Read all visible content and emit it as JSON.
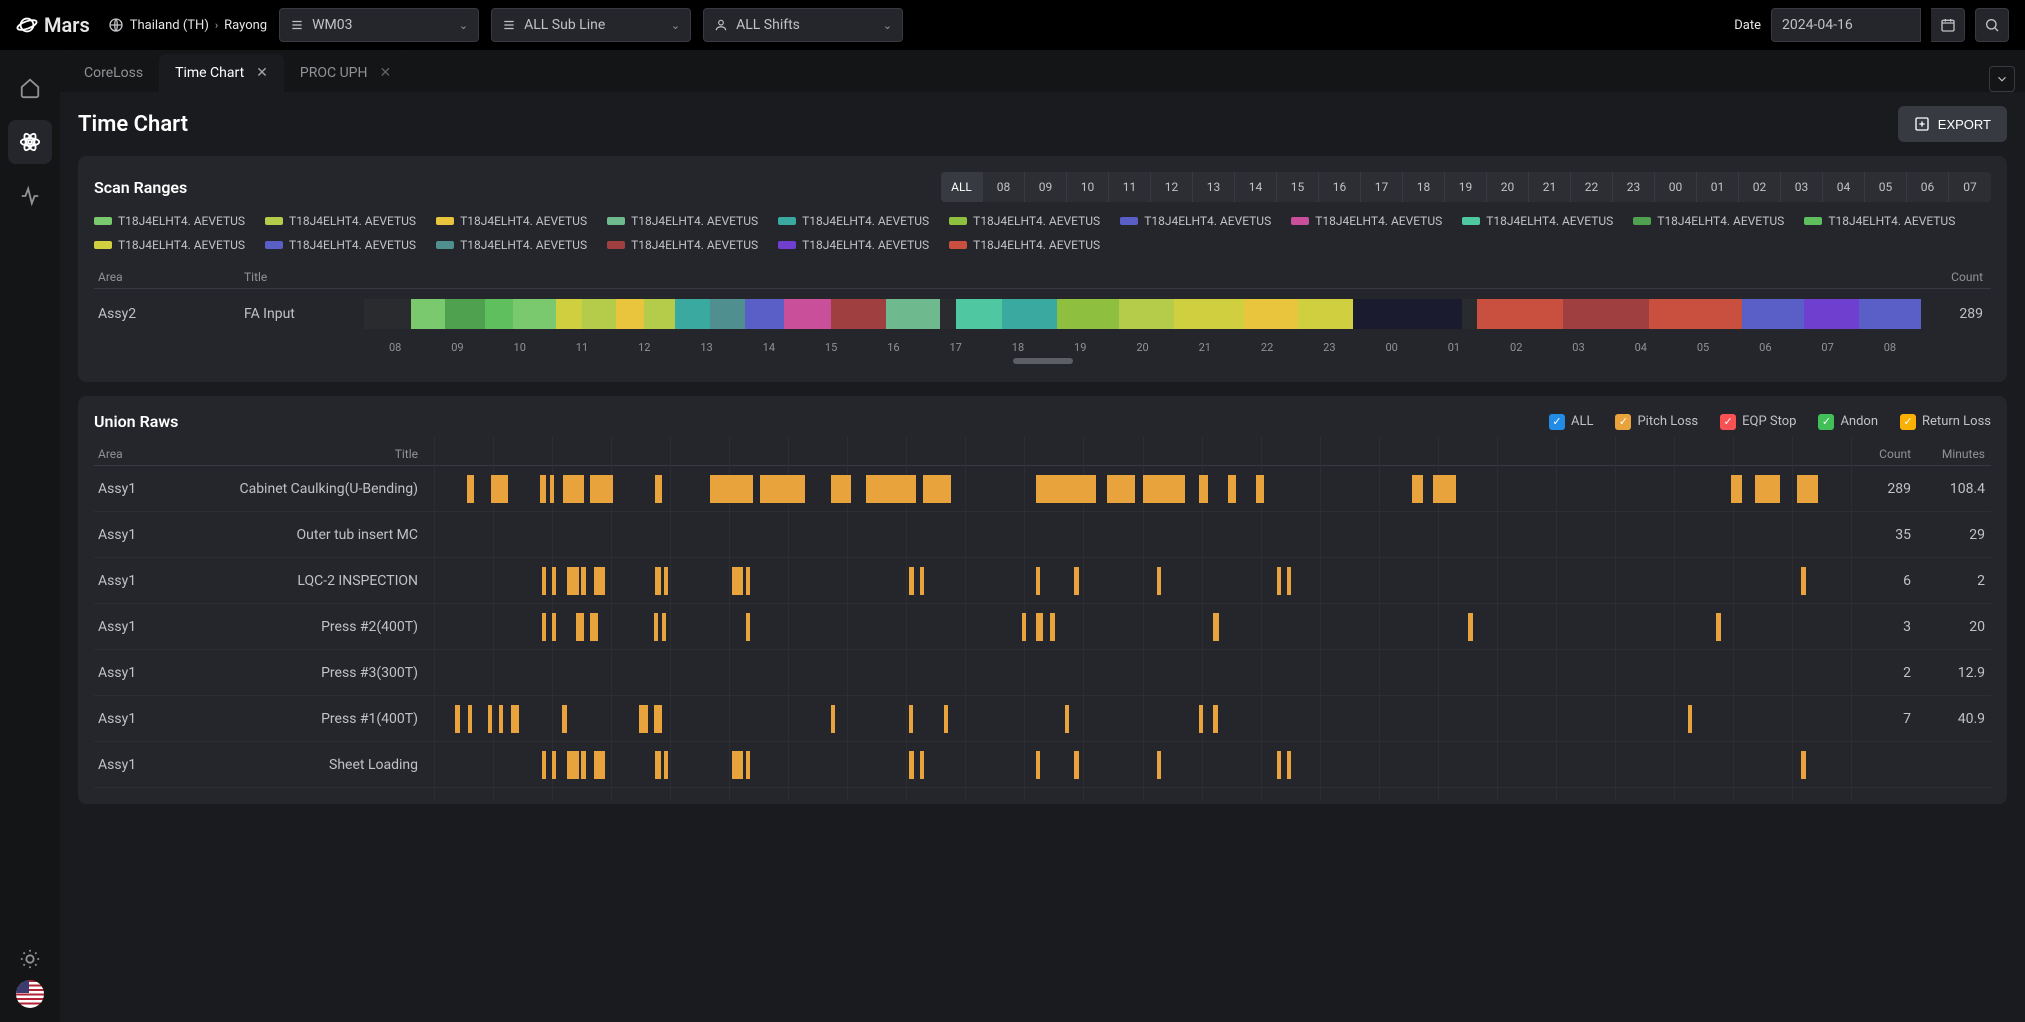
{
  "brand": "Mars",
  "breadcrumb": {
    "region": "Thailand (TH)",
    "factory": "Rayong"
  },
  "selects": {
    "wm": "WM03",
    "subline": "ALL Sub Line",
    "shift": "ALL Shifts"
  },
  "date_label": "Date",
  "date_value": "2024-04-16",
  "tabs": [
    {
      "id": "coreloss",
      "label": "CoreLoss",
      "active": false,
      "closable": false
    },
    {
      "id": "timechart",
      "label": "Time Chart",
      "active": true,
      "closable": true
    },
    {
      "id": "procuph",
      "label": "PROC UPH",
      "active": false,
      "closable": true
    }
  ],
  "page_title": "Time Chart",
  "export_label": "EXPORT",
  "scan": {
    "title": "Scan Ranges",
    "hours": [
      "ALL",
      "08",
      "09",
      "10",
      "11",
      "12",
      "13",
      "14",
      "15",
      "16",
      "17",
      "18",
      "19",
      "20",
      "21",
      "22",
      "23",
      "00",
      "01",
      "02",
      "03",
      "04",
      "05",
      "06",
      "07"
    ],
    "active_hour": "ALL",
    "legend_label": "T18J4ELHT4. AEVETUS",
    "legend_colors": [
      "#7bc96f",
      "#b5cc4a",
      "#e8c53d",
      "#6fb98f",
      "#3aa99f",
      "#8fbf3f",
      "#5a5fc7",
      "#c94f9a",
      "#4fc7a0",
      "#4fa04f",
      "#5fbf5f",
      "#cfcf3f",
      "#5a5fc7",
      "#4f8f8f",
      "#9f3f3f",
      "#6f3fcf",
      "#c94f3f"
    ],
    "headers": {
      "area": "Area",
      "title": "Title",
      "count": "Count"
    },
    "row": {
      "area": "Assy2",
      "title": "FA Input",
      "count": 289
    },
    "axis": [
      "08",
      "09",
      "10",
      "11",
      "12",
      "13",
      "14",
      "15",
      "16",
      "17",
      "18",
      "19",
      "20",
      "21",
      "22",
      "23",
      "00",
      "01",
      "02",
      "03",
      "04",
      "05",
      "06",
      "07",
      "08"
    ],
    "segments": [
      {
        "s": 0.0,
        "e": 3.0,
        "c": "#2a2b2e"
      },
      {
        "s": 3.0,
        "e": 5.2,
        "c": "#7bc96f"
      },
      {
        "s": 5.2,
        "e": 7.8,
        "c": "#4fa04f"
      },
      {
        "s": 7.8,
        "e": 9.6,
        "c": "#5fbf5f"
      },
      {
        "s": 9.6,
        "e": 12.3,
        "c": "#7bc96f"
      },
      {
        "s": 12.3,
        "e": 14.0,
        "c": "#cfcf3f"
      },
      {
        "s": 14.0,
        "e": 16.2,
        "c": "#b5cc4a"
      },
      {
        "s": 16.2,
        "e": 18.0,
        "c": "#e8c53d"
      },
      {
        "s": 18.0,
        "e": 20.0,
        "c": "#b5cc4a"
      },
      {
        "s": 20.0,
        "e": 22.2,
        "c": "#3aa99f"
      },
      {
        "s": 22.2,
        "e": 24.5,
        "c": "#4f8f8f"
      },
      {
        "s": 24.5,
        "e": 27.0,
        "c": "#5a5fc7"
      },
      {
        "s": 27.0,
        "e": 30.0,
        "c": "#c94f9a"
      },
      {
        "s": 30.0,
        "e": 33.5,
        "c": "#9f3f3f"
      },
      {
        "s": 33.5,
        "e": 37.0,
        "c": "#6fb98f"
      },
      {
        "s": 37.0,
        "e": 38.0,
        "c": "#2a2b2e"
      },
      {
        "s": 38.0,
        "e": 41.0,
        "c": "#4fc7a0"
      },
      {
        "s": 41.0,
        "e": 44.5,
        "c": "#3aa99f"
      },
      {
        "s": 44.5,
        "e": 48.5,
        "c": "#8fbf3f"
      },
      {
        "s": 48.5,
        "e": 52.0,
        "c": "#b5cc4a"
      },
      {
        "s": 52.0,
        "e": 56.5,
        "c": "#cfcf3f"
      },
      {
        "s": 56.5,
        "e": 60.0,
        "c": "#e8c53d"
      },
      {
        "s": 60.0,
        "e": 63.5,
        "c": "#cfcf3f"
      },
      {
        "s": 63.5,
        "e": 70.5,
        "c": "#1a1b2e"
      },
      {
        "s": 70.5,
        "e": 71.5,
        "c": "#2a2b2e"
      },
      {
        "s": 71.5,
        "e": 77.0,
        "c": "#c94f3f"
      },
      {
        "s": 77.0,
        "e": 82.5,
        "c": "#9f3f3f"
      },
      {
        "s": 82.5,
        "e": 88.5,
        "c": "#c94f3f"
      },
      {
        "s": 88.5,
        "e": 92.5,
        "c": "#5a5fc7"
      },
      {
        "s": 92.5,
        "e": 96.0,
        "c": "#6f3fcf"
      },
      {
        "s": 96.0,
        "e": 100.0,
        "c": "#5a5fc7"
      }
    ]
  },
  "union": {
    "title": "Union Raws",
    "filters": [
      {
        "label": "ALL",
        "color": "#228be6"
      },
      {
        "label": "Pitch Loss",
        "color": "#e8a33d"
      },
      {
        "label": "EQP Stop",
        "color": "#fa5252"
      },
      {
        "label": "Andon",
        "color": "#40c057"
      },
      {
        "label": "Return Loss",
        "color": "#fab005"
      }
    ],
    "headers": {
      "area": "Area",
      "title": "Title",
      "count": "Count",
      "minutes": "Minutes"
    },
    "rows": [
      {
        "area": "Assy1",
        "title": "Cabinet Caulking(U-Bending)",
        "count": 289,
        "minutes": 108.4,
        "segs": [
          {
            "s": 2.3,
            "w": 0.5
          },
          {
            "s": 4.0,
            "w": 1.2
          },
          {
            "s": 7.5,
            "w": 0.4
          },
          {
            "s": 8.2,
            "w": 0.3
          },
          {
            "s": 9.1,
            "w": 1.5
          },
          {
            "s": 11.0,
            "w": 1.6
          },
          {
            "s": 15.6,
            "w": 0.5
          },
          {
            "s": 19.5,
            "w": 3.0
          },
          {
            "s": 23.0,
            "w": 3.2
          },
          {
            "s": 28.0,
            "w": 1.4
          },
          {
            "s": 30.5,
            "w": 3.5
          },
          {
            "s": 34.5,
            "w": 2.0
          },
          {
            "s": 42.5,
            "w": 4.2
          },
          {
            "s": 47.5,
            "w": 2.0
          },
          {
            "s": 50.0,
            "w": 3.0
          },
          {
            "s": 54.0,
            "w": 0.6
          },
          {
            "s": 56.0,
            "w": 0.6
          },
          {
            "s": 58.0,
            "w": 0.6
          },
          {
            "s": 69.0,
            "w": 0.8
          },
          {
            "s": 70.5,
            "w": 1.6
          },
          {
            "s": 91.5,
            "w": 0.8
          },
          {
            "s": 93.2,
            "w": 1.8
          },
          {
            "s": 96.2,
            "w": 1.5
          }
        ]
      },
      {
        "area": "Assy1",
        "title": "Outer tub insert MC",
        "count": 35,
        "minutes": 29.0,
        "segs": []
      },
      {
        "area": "Assy1",
        "title": "LQC-2 INSPECTION",
        "count": 6,
        "minutes": 2.0,
        "segs": [
          {
            "s": 7.6,
            "w": 0.3
          },
          {
            "s": 8.3,
            "w": 0.3
          },
          {
            "s": 9.4,
            "w": 0.8
          },
          {
            "s": 10.4,
            "w": 0.3
          },
          {
            "s": 11.3,
            "w": 0.8
          },
          {
            "s": 15.6,
            "w": 0.4
          },
          {
            "s": 16.2,
            "w": 0.3
          },
          {
            "s": 21.0,
            "w": 0.8
          },
          {
            "s": 22.0,
            "w": 0.3
          },
          {
            "s": 33.5,
            "w": 0.4
          },
          {
            "s": 34.3,
            "w": 0.3
          },
          {
            "s": 42.5,
            "w": 0.3
          },
          {
            "s": 45.2,
            "w": 0.3
          },
          {
            "s": 51.0,
            "w": 0.3
          },
          {
            "s": 59.5,
            "w": 0.3
          },
          {
            "s": 60.2,
            "w": 0.3
          },
          {
            "s": 96.5,
            "w": 0.3
          }
        ]
      },
      {
        "area": "Assy1",
        "title": "Press #2(400T)",
        "count": 3,
        "minutes": 20.0,
        "segs": [
          {
            "s": 7.6,
            "w": 0.3
          },
          {
            "s": 8.3,
            "w": 0.3
          },
          {
            "s": 10.0,
            "w": 0.6
          },
          {
            "s": 11.0,
            "w": 0.6
          },
          {
            "s": 15.5,
            "w": 0.3
          },
          {
            "s": 16.1,
            "w": 0.3
          },
          {
            "s": 22.0,
            "w": 0.3
          },
          {
            "s": 41.5,
            "w": 0.3
          },
          {
            "s": 42.5,
            "w": 0.5
          },
          {
            "s": 43.5,
            "w": 0.3
          },
          {
            "s": 55.0,
            "w": 0.4
          },
          {
            "s": 73.0,
            "w": 0.3
          },
          {
            "s": 90.5,
            "w": 0.3
          }
        ]
      },
      {
        "area": "Assy1",
        "title": "Press #3(300T)",
        "count": 2,
        "minutes": 12.9,
        "segs": []
      },
      {
        "area": "Assy1",
        "title": "Press #1(400T)",
        "count": 7,
        "minutes": 40.9,
        "segs": [
          {
            "s": 1.5,
            "w": 0.3
          },
          {
            "s": 2.4,
            "w": 0.3
          },
          {
            "s": 3.8,
            "w": 0.3
          },
          {
            "s": 4.6,
            "w": 0.3
          },
          {
            "s": 5.4,
            "w": 0.6
          },
          {
            "s": 9.0,
            "w": 0.4
          },
          {
            "s": 14.5,
            "w": 0.6
          },
          {
            "s": 15.5,
            "w": 0.6
          },
          {
            "s": 28.0,
            "w": 0.3
          },
          {
            "s": 33.5,
            "w": 0.3
          },
          {
            "s": 36.0,
            "w": 0.3
          },
          {
            "s": 44.5,
            "w": 0.3
          },
          {
            "s": 54.0,
            "w": 0.3
          },
          {
            "s": 55.0,
            "w": 0.3
          },
          {
            "s": 88.5,
            "w": 0.3
          }
        ]
      },
      {
        "area": "Assy1",
        "title": "Sheet Loading",
        "count": "",
        "minutes": "",
        "segs": [
          {
            "s": 7.6,
            "w": 0.3
          },
          {
            "s": 8.3,
            "w": 0.3
          },
          {
            "s": 9.4,
            "w": 0.8
          },
          {
            "s": 10.4,
            "w": 0.3
          },
          {
            "s": 11.3,
            "w": 0.8
          },
          {
            "s": 15.6,
            "w": 0.4
          },
          {
            "s": 16.2,
            "w": 0.3
          },
          {
            "s": 21.0,
            "w": 0.8
          },
          {
            "s": 22.0,
            "w": 0.3
          },
          {
            "s": 33.5,
            "w": 0.4
          },
          {
            "s": 34.3,
            "w": 0.3
          },
          {
            "s": 42.5,
            "w": 0.3
          },
          {
            "s": 45.2,
            "w": 0.3
          },
          {
            "s": 51.0,
            "w": 0.3
          },
          {
            "s": 59.5,
            "w": 0.3
          },
          {
            "s": 60.2,
            "w": 0.3
          },
          {
            "s": 96.5,
            "w": 0.3
          }
        ]
      }
    ]
  },
  "chart_data": {
    "type": "bar",
    "title": "Union Raws — Pitch Loss events",
    "time_axis_hours": [
      "08",
      "09",
      "10",
      "11",
      "12",
      "13",
      "14",
      "15",
      "16",
      "17",
      "18",
      "19",
      "20",
      "21",
      "22",
      "23",
      "00",
      "01",
      "02",
      "03",
      "04",
      "05",
      "06",
      "07",
      "08"
    ],
    "series": [
      {
        "name": "Cabinet Caulking(U-Bending)",
        "count": 289,
        "minutes": 108.4
      },
      {
        "name": "Outer tub insert MC",
        "count": 35,
        "minutes": 29.0
      },
      {
        "name": "LQC-2 INSPECTION",
        "count": 6,
        "minutes": 2.0
      },
      {
        "name": "Press #2(400T)",
        "count": 3,
        "minutes": 20.0
      },
      {
        "name": "Press #3(300T)",
        "count": 2,
        "minutes": 12.9
      },
      {
        "name": "Press #1(400T)",
        "count": 7,
        "minutes": 40.9
      }
    ],
    "scan_ranges": {
      "area": "Assy2",
      "title": "FA Input",
      "count": 289
    }
  }
}
